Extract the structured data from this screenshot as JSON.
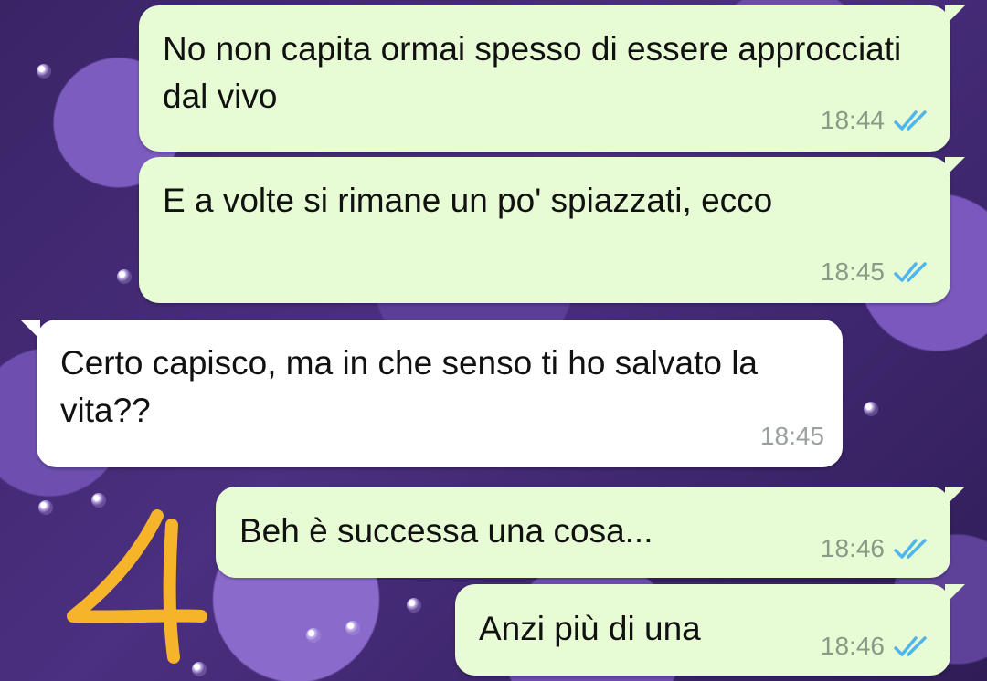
{
  "chat": {
    "messages": [
      {
        "direction": "outgoing",
        "text": "No non capita ormai spesso di essere approcciati dal vivo",
        "time": "18:44",
        "status": "read"
      },
      {
        "direction": "outgoing",
        "text": "E a volte si rimane un po' spiazzati, ecco",
        "time": "18:45",
        "status": "read"
      },
      {
        "direction": "incoming",
        "text": "Certo capisco, ma in che senso ti ho salvato la vita??",
        "time": "18:45"
      },
      {
        "direction": "outgoing",
        "text": "Beh è successa una cosa...",
        "time": "18:46",
        "status": "read"
      },
      {
        "direction": "outgoing",
        "text": "Anzi più di una",
        "time": "18:46",
        "status": "read"
      }
    ]
  },
  "annotation": {
    "text": "4",
    "color": "#f6b42a"
  },
  "colors": {
    "outgoing_bubble": "#e7fbd4",
    "incoming_bubble": "#ffffff",
    "read_ticks": "#4fb6ec"
  },
  "icons": {
    "status": "double-check-icon"
  }
}
